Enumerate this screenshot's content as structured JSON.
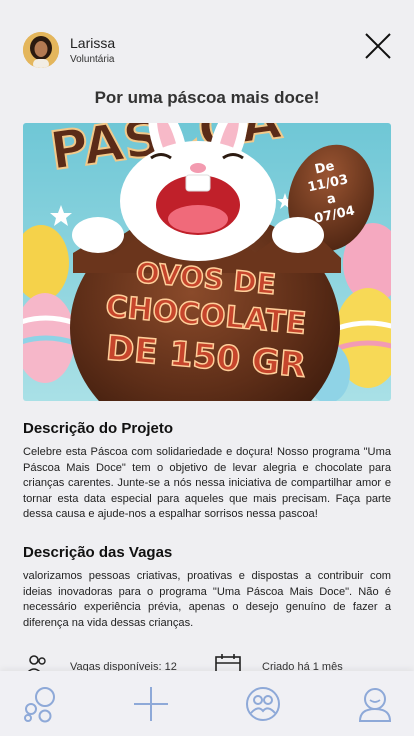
{
  "header": {
    "user_name": "Larissa",
    "user_role": "Voluntária"
  },
  "page_title": "Por uma páscoa mais doce!",
  "banner": {
    "title_text": "PÁSCOA",
    "badge_text": [
      "De",
      "11/03",
      "a",
      "07/04"
    ],
    "egg_text": [
      "OVOS DE",
      "CHOCOLATE",
      "DE 150 GR"
    ]
  },
  "project": {
    "title": "Descrição do Projeto",
    "text": "Celebre esta Páscoa com solidariedade e doçura! Nosso programa \"Uma Páscoa Mais Doce\" tem o objetivo de levar alegria e chocolate para crianças carentes. Junte-se a nós nessa iniciativa de compartilhar amor e tornar esta data especial para aqueles que mais precisam. Faça parte dessa causa e ajude-nos a espalhar sorrisos nessa pascoa!"
  },
  "vacancies": {
    "title": "Descrição das Vagas",
    "text": "valorizamos pessoas criativas, proativas e dispostas a contribuir com ideias inovadoras para o programa \"Uma Páscoa Mais Doce\". Não é necessário experiência prévia, apenas o desejo genuíno de fazer a diferença na vida dessas crianças."
  },
  "stats": {
    "vacancies_available": "Vagas disponíveis: 12",
    "created": "Criado há 1 mês"
  },
  "colors": {
    "accent": "#8ea9d8",
    "background": "#efeff2",
    "chocolate": "#5a2b17"
  },
  "icons": {
    "close": "close-icon",
    "people": "people-icon",
    "calendar": "calendar-icon",
    "bubbles": "bubbles-icon",
    "plus": "plus-icon",
    "group": "group-icon",
    "profile": "profile-icon"
  }
}
